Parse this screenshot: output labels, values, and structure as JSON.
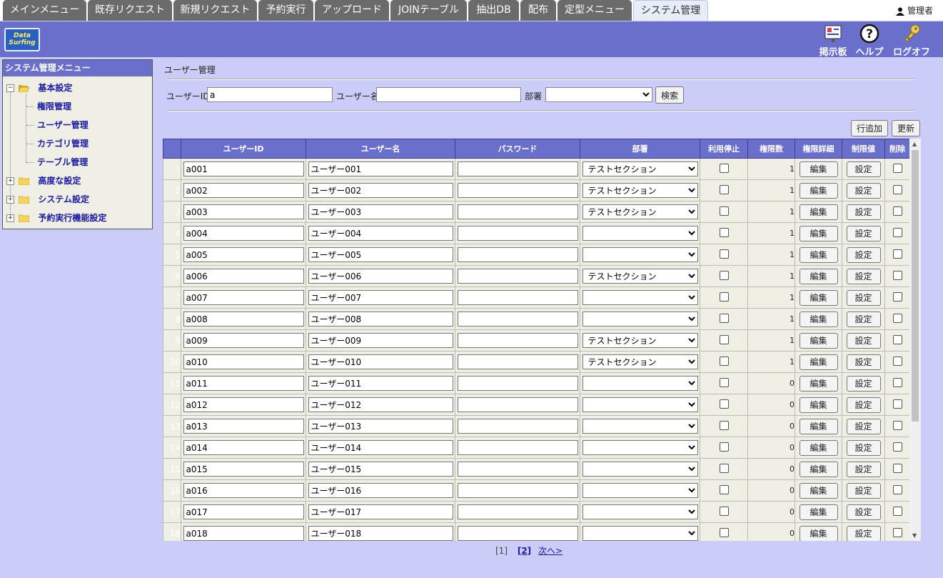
{
  "tabs": [
    {
      "label": "メインメニュー",
      "active": false
    },
    {
      "label": "既存リクエスト",
      "active": false
    },
    {
      "label": "新規リクエスト",
      "active": false
    },
    {
      "label": "予約実行",
      "active": false
    },
    {
      "label": "アップロード",
      "active": false
    },
    {
      "label": "JOINテーブル",
      "active": false
    },
    {
      "label": "抽出DB",
      "active": false
    },
    {
      "label": "配布",
      "active": false
    },
    {
      "label": "定型メニュー",
      "active": false
    },
    {
      "label": "システム管理",
      "active": true
    }
  ],
  "user": {
    "name": "管理者"
  },
  "logo": {
    "text": "Data Surfing"
  },
  "header_buttons": {
    "board": "掲示板",
    "help": "ヘルプ",
    "logoff": "ログオフ"
  },
  "sidebar": {
    "title": "システム管理メニュー",
    "groups": [
      {
        "label": "基本設定",
        "expanded": true,
        "children": [
          "権限管理",
          "ユーザー管理",
          "カテゴリ管理",
          "テーブル管理"
        ]
      },
      {
        "label": "高度な設定",
        "expanded": false
      },
      {
        "label": "システム設定",
        "expanded": false
      },
      {
        "label": "予約実行機能設定",
        "expanded": false
      }
    ]
  },
  "page_title": "ユーザー管理",
  "search": {
    "userid_label": "ユーザーID",
    "userid_value": "a",
    "username_label": "ユーザー名",
    "username_value": "",
    "dept_label": "部署",
    "dept_value": "",
    "search_button": "検索"
  },
  "actions": {
    "add_row": "行追加",
    "update": "更新"
  },
  "table": {
    "columns": [
      "ユーザーID",
      "ユーザー名",
      "パスワード",
      "部署",
      "利用停止",
      "権限数",
      "権限詳細",
      "制限値",
      "削除"
    ],
    "edit_label": "編集",
    "setting_label": "設定",
    "rows": [
      {
        "no": "1",
        "id": "a001",
        "name": "ユーザー001",
        "password": "",
        "dept": "テストセクション",
        "suspended": false,
        "perm_count": "1",
        "delete": false
      },
      {
        "no": "2",
        "id": "a002",
        "name": "ユーザー002",
        "password": "",
        "dept": "テストセクション",
        "suspended": false,
        "perm_count": "1",
        "delete": false
      },
      {
        "no": "3",
        "id": "a003",
        "name": "ユーザー003",
        "password": "",
        "dept": "テストセクション",
        "suspended": false,
        "perm_count": "1",
        "delete": false
      },
      {
        "no": "4",
        "id": "a004",
        "name": "ユーザー004",
        "password": "",
        "dept": "",
        "suspended": false,
        "perm_count": "1",
        "delete": false
      },
      {
        "no": "5",
        "id": "a005",
        "name": "ユーザー005",
        "password": "",
        "dept": "",
        "suspended": false,
        "perm_count": "1",
        "delete": false
      },
      {
        "no": "6",
        "id": "a006",
        "name": "ユーザー006",
        "password": "",
        "dept": "テストセクション",
        "suspended": false,
        "perm_count": "1",
        "delete": false
      },
      {
        "no": "7",
        "id": "a007",
        "name": "ユーザー007",
        "password": "",
        "dept": "",
        "suspended": false,
        "perm_count": "1",
        "delete": false
      },
      {
        "no": "8",
        "id": "a008",
        "name": "ユーザー008",
        "password": "",
        "dept": "",
        "suspended": false,
        "perm_count": "1",
        "delete": false
      },
      {
        "no": "9",
        "id": "a009",
        "name": "ユーザー009",
        "password": "",
        "dept": "テストセクション",
        "suspended": false,
        "perm_count": "1",
        "delete": false
      },
      {
        "no": "10",
        "id": "a010",
        "name": "ユーザー010",
        "password": "",
        "dept": "テストセクション",
        "suspended": false,
        "perm_count": "1",
        "delete": false
      },
      {
        "no": "11",
        "id": "a011",
        "name": "ユーザー011",
        "password": "",
        "dept": "",
        "suspended": false,
        "perm_count": "0",
        "delete": false
      },
      {
        "no": "12",
        "id": "a012",
        "name": "ユーザー012",
        "password": "",
        "dept": "",
        "suspended": false,
        "perm_count": "0",
        "delete": false
      },
      {
        "no": "13",
        "id": "a013",
        "name": "ユーザー013",
        "password": "",
        "dept": "",
        "suspended": false,
        "perm_count": "0",
        "delete": false
      },
      {
        "no": "14",
        "id": "a014",
        "name": "ユーザー014",
        "password": "",
        "dept": "",
        "suspended": false,
        "perm_count": "0",
        "delete": false
      },
      {
        "no": "15",
        "id": "a015",
        "name": "ユーザー015",
        "password": "",
        "dept": "",
        "suspended": false,
        "perm_count": "0",
        "delete": false
      },
      {
        "no": "16",
        "id": "a016",
        "name": "ユーザー016",
        "password": "",
        "dept": "",
        "suspended": false,
        "perm_count": "0",
        "delete": false
      },
      {
        "no": "17",
        "id": "a017",
        "name": "ユーザー017",
        "password": "",
        "dept": "",
        "suspended": false,
        "perm_count": "0",
        "delete": false
      },
      {
        "no": "18",
        "id": "a018",
        "name": "ユーザー018",
        "password": "",
        "dept": "",
        "suspended": false,
        "perm_count": "0",
        "delete": false
      }
    ]
  },
  "pagination": {
    "current": "[1]",
    "page2": "[2]",
    "next": "次へ>"
  }
}
